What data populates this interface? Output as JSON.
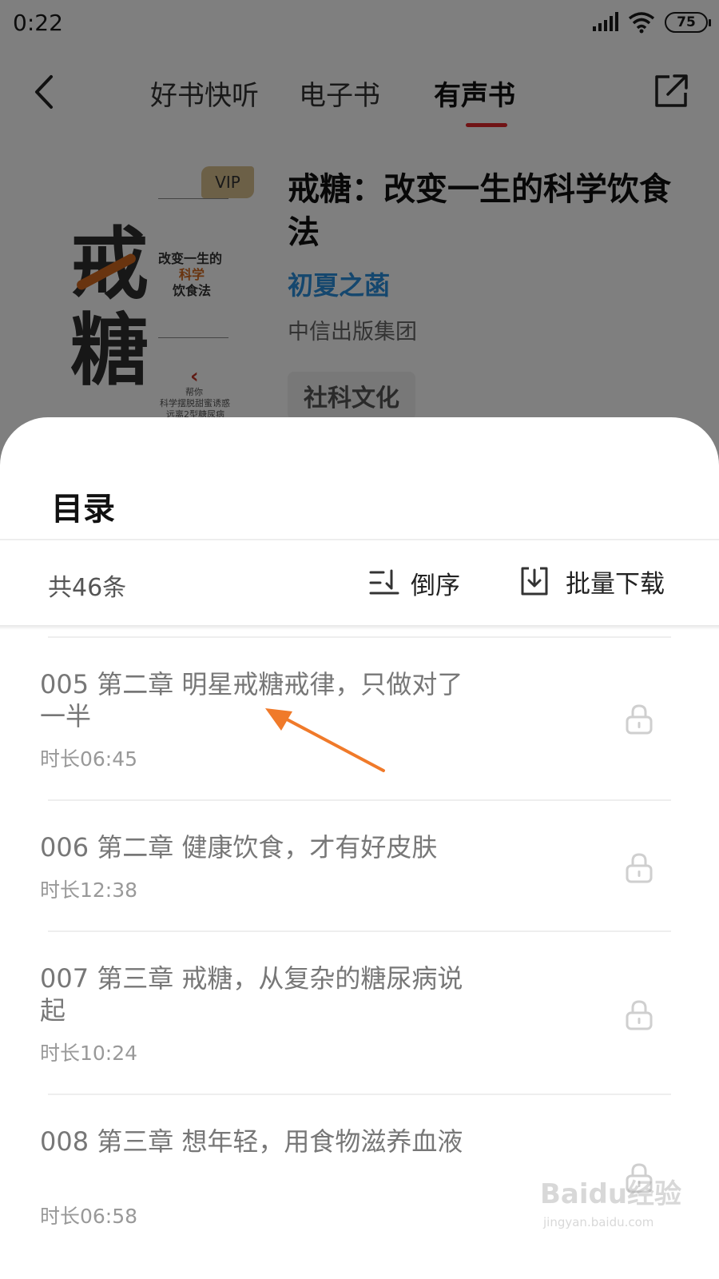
{
  "status_bar": {
    "time": "0:22",
    "battery": "75"
  },
  "nav": {
    "tabs": [
      {
        "label": "好书快听"
      },
      {
        "label": "电子书"
      },
      {
        "label": "有声书"
      }
    ],
    "active_tab": "有声书",
    "accent_color": "#e0262b"
  },
  "book": {
    "title": "戒糖：改变一生的科学饮食法",
    "author": "初夏之菡",
    "publisher": "中信出版集团",
    "tag": "社科文化",
    "cover": {
      "vip_badge": "VIP",
      "big_char_1": "戒",
      "big_char_2": "糖",
      "subtitle_1": "改变一生的",
      "subtitle_2": "科学",
      "subtitle_3": "饮食法",
      "small_1": "帮你",
      "small_2": "科学摆脱甜蜜诱惑",
      "small_3": "远离2型糖尿病"
    }
  },
  "sheet": {
    "title": "目录",
    "total": "共46条",
    "sort_label": "倒序",
    "download_label": "批量下载",
    "chapters": [
      {
        "name": "005 第二章 明星戒糖戒律，只做对了一半",
        "duration": "时长06:45",
        "locked": true
      },
      {
        "name": "006 第二章 健康饮食，才有好皮肤",
        "duration": "时长12:38",
        "locked": true
      },
      {
        "name": "007 第三章 戒糖，从复杂的糖尿病说起",
        "duration": "时长10:24",
        "locked": true
      },
      {
        "name": "008 第三章 想年轻，用食物滋养血液",
        "duration": "时长06:58",
        "locked": true
      }
    ]
  },
  "annotation": {
    "arrow_color": "#f07a2a"
  },
  "watermark": {
    "main": "Baidu经验",
    "url": "jingyan.baidu.com"
  }
}
